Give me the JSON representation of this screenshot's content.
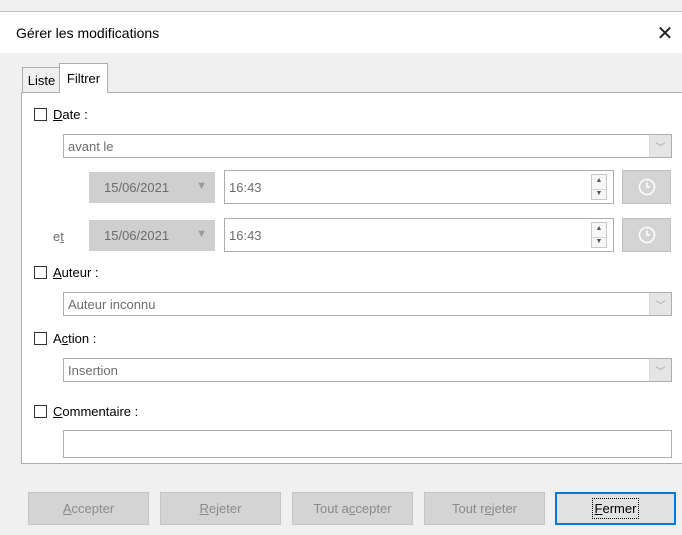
{
  "window": {
    "title": "Gérer les modifications",
    "close_glyph": "✕"
  },
  "tabs": [
    {
      "label": "Liste",
      "active": false
    },
    {
      "label": "Filtrer",
      "active": true
    }
  ],
  "filter": {
    "date": {
      "label_u": "D",
      "label_rest": "ate :",
      "checked": false,
      "condition": "avant le"
    },
    "from": {
      "date": "15/06/2021",
      "time": "16:43"
    },
    "to": {
      "label_pre": "e",
      "label_u": "t",
      "date": "15/06/2021",
      "time": "16:43"
    },
    "author": {
      "label_u": "A",
      "label_rest": "uteur :",
      "checked": false,
      "value": "Auteur inconnu"
    },
    "action": {
      "label_pre": "A",
      "label_u": "c",
      "label_rest": "tion :",
      "checked": false,
      "value": "Insertion"
    },
    "comment": {
      "label_u": "C",
      "label_rest": "ommentaire :",
      "checked": false,
      "value": ""
    }
  },
  "buttons": {
    "accept": {
      "u": "A",
      "rest": "ccepter"
    },
    "reject": {
      "u": "R",
      "rest": "ejeter"
    },
    "accept_all": {
      "pre": "Tout a",
      "u": "c",
      "rest": "cepter"
    },
    "reject_all": {
      "pre": "Tout r",
      "u": "e",
      "rest": "jeter"
    },
    "close": {
      "u": "F",
      "rest": "ermer"
    }
  },
  "icons": {
    "dropdown": "chevron-down-icon",
    "spin_up": "▲",
    "spin_down": "▼",
    "combo_arrow": "﹀",
    "date_arrow": "▼"
  },
  "colors": {
    "focus_border": "#0078d7",
    "disabled_text": "#8a8a8a"
  }
}
